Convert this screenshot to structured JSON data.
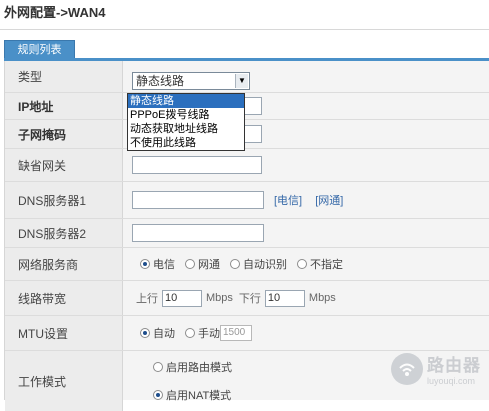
{
  "page": {
    "title": "外网配置->WAN4"
  },
  "tab": {
    "label": "规则列表"
  },
  "type": {
    "label": "类型",
    "selected": "静态线路",
    "options": [
      "静态线路",
      "PPPoE拨号线路",
      "动态获取地址线路",
      "不使用此线路"
    ]
  },
  "ip": {
    "label": "IP地址"
  },
  "mask": {
    "label": "子网掩码"
  },
  "gateway": {
    "label": "缺省网关"
  },
  "dns1": {
    "label": "DNS服务器1",
    "links": [
      "[电信]",
      "[网通]"
    ]
  },
  "dns2": {
    "label": "DNS服务器2"
  },
  "isp": {
    "label": "网络服务商",
    "options": [
      "电信",
      "网通",
      "自动识别",
      "不指定"
    ]
  },
  "bandwidth": {
    "label": "线路带宽",
    "up_label": "上行",
    "up_value": "10",
    "down_label": "下行",
    "down_value": "10",
    "unit": "Mbps"
  },
  "mtu": {
    "label": "MTU设置",
    "auto": "自动",
    "manual": "手动",
    "value": "1500"
  },
  "mode": {
    "label": "工作模式",
    "options": [
      "启用路由模式",
      "启用NAT模式"
    ]
  },
  "watermark": {
    "main": "路由器",
    "sub": "luyouqi.com"
  }
}
